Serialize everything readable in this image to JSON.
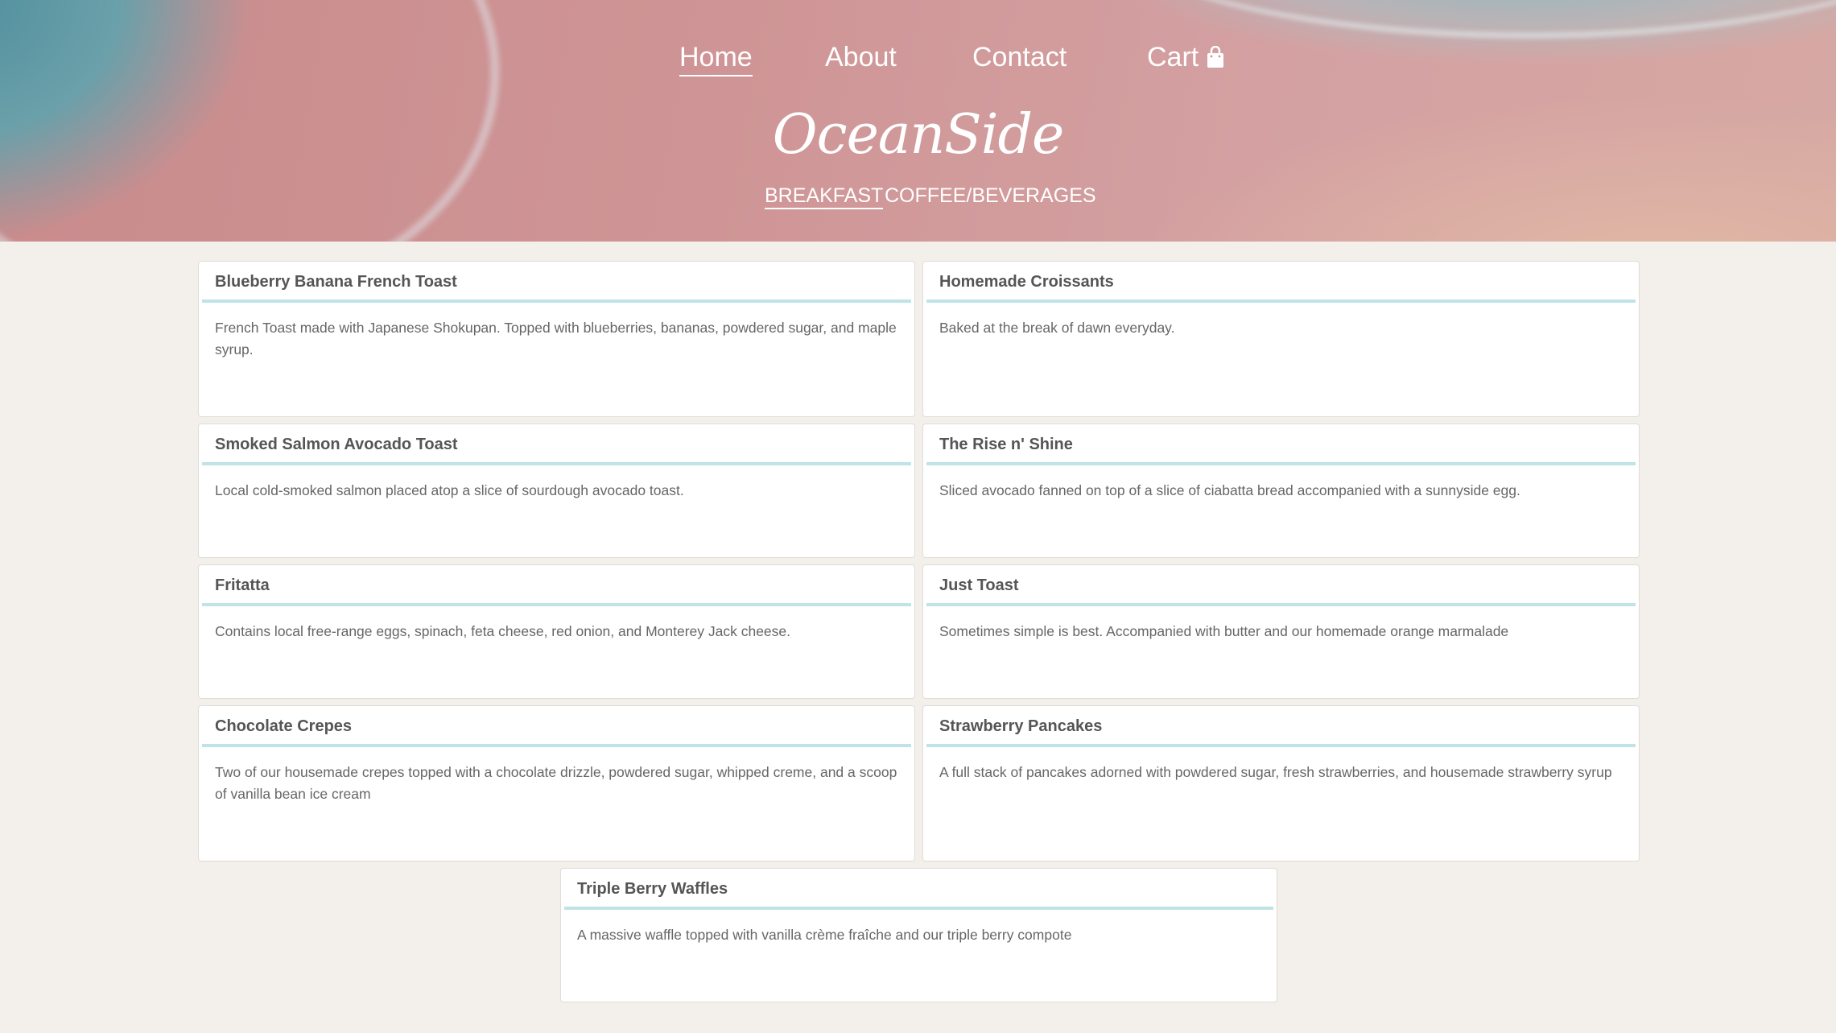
{
  "nav": {
    "items": [
      {
        "label": "Home"
      },
      {
        "label": "About"
      },
      {
        "label": "Contact"
      },
      {
        "label": "Cart"
      }
    ]
  },
  "brand": {
    "name": "OceanSide"
  },
  "categories": [
    {
      "label": "BREAKFAST"
    },
    {
      "label": "COFFEE/BEVERAGES"
    }
  ],
  "menu": [
    {
      "name": "Blueberry Banana French Toast",
      "description": "French Toast made with Japanese Shokupan. Topped with blueberries, bananas, powdered sugar, and maple syrup."
    },
    {
      "name": "Homemade Croissants",
      "description": "Baked at the break of dawn everyday."
    },
    {
      "name": "Smoked Salmon Avocado Toast",
      "description": "Local cold-smoked salmon placed atop a slice of sourdough avocado toast."
    },
    {
      "name": "The Rise n' Shine",
      "description": "Sliced avocado fanned on top of a slice of ciabatta bread accompanied with a sunnyside egg."
    },
    {
      "name": "Fritatta",
      "description": "Contains local free-range eggs, spinach, feta cheese, red onion, and Monterey Jack cheese."
    },
    {
      "name": "Just Toast",
      "description": "Sometimes simple is best. Accompanied with butter and our homemade orange marmalade"
    },
    {
      "name": "Chocolate Crepes",
      "description": "Two of our housemade crepes topped with a chocolate drizzle, powdered sugar, whipped creme, and a scoop of vanilla bean ice cream"
    },
    {
      "name": "Strawberry Pancakes",
      "description": "A full stack of pancakes adorned with powdered sugar, fresh strawberries, and housemade strawberry syrup"
    },
    {
      "name": "Triple Berry Waffles",
      "description": "A massive waffle topped with vanilla crème fraîche and our triple berry compote"
    }
  ],
  "colors": {
    "accent_underline": "#bfe3e6",
    "page_background": "#f3efea",
    "hero_pink": "#cf9596"
  },
  "icons": {
    "cart": "shopping-bag-icon"
  }
}
